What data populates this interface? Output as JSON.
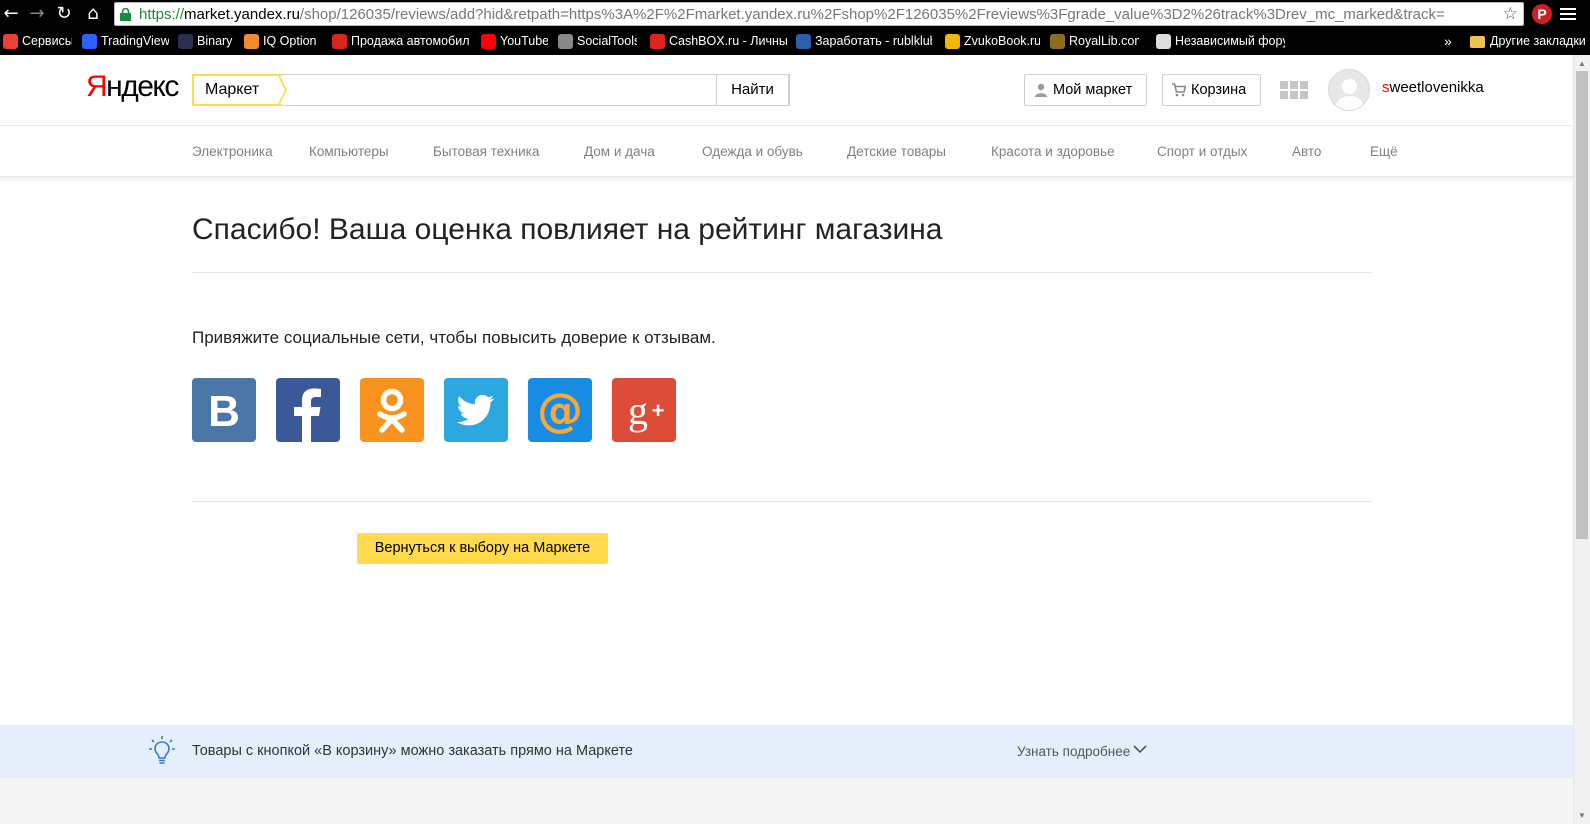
{
  "browser": {
    "url_https": "https://",
    "url_host": "market.yandex.ru",
    "url_path": "/shop/126035/reviews/add?hid&retpath=https%3A%2F%2Fmarket.yandex.ru%2Fshop%2F126035%2Freviews%3Fgrade_value%3D2%26track%3Drev_mc_marked&track="
  },
  "bookmarks": [
    {
      "label": "Сервисы",
      "icon": "apps-icon",
      "color": "#e94235"
    },
    {
      "label": "TradingView",
      "icon": "tradingview-icon",
      "color": "#2962ff"
    },
    {
      "label": "Binary",
      "icon": "binary-icon",
      "color": "#2a3052"
    },
    {
      "label": "IQ Option",
      "icon": "iq-option-icon",
      "color": "#f28c28"
    },
    {
      "label": "Продажа автомобил",
      "icon": "auto-icon",
      "color": "#d9261c"
    },
    {
      "label": "YouTube",
      "icon": "youtube-icon",
      "color": "#ff0000"
    },
    {
      "label": "SocialTools",
      "icon": "socialtools-icon",
      "color": "#888888"
    },
    {
      "label": "CashBOX.ru - Личный",
      "icon": "cashbox-icon",
      "color": "#e2231a"
    },
    {
      "label": "Заработать - rublklub",
      "icon": "rublklub-icon",
      "color": "#2b5fae"
    },
    {
      "label": "ZvukoBook.ru",
      "icon": "zvukobook-icon",
      "color": "#f2b705"
    },
    {
      "label": "RoyalLib.com",
      "icon": "royallib-icon",
      "color": "#8a6d1f"
    },
    {
      "label": "Независимый форум",
      "icon": "page-icon",
      "color": "#dddddd"
    }
  ],
  "bookmarks_more": "»",
  "bookmarks_other": "Другие закладки",
  "header": {
    "logo_first": "Я",
    "logo_rest": "ндекс",
    "search_tag": "Маркет",
    "search_button": "Найти",
    "my_market": "Мой маркет",
    "cart": "Корзина",
    "username_first": "s",
    "username_rest": "weetlovenikka"
  },
  "categories": [
    "Электроника",
    "Компьютеры",
    "Бытовая техника",
    "Дом и дача",
    "Одежда и обувь",
    "Детские товары",
    "Красота и здоровье",
    "Спорт и отдых",
    "Авто",
    "Ещё"
  ],
  "main": {
    "title": "Спасибо! Ваша оценка повлияет на рейтинг магазина",
    "subtitle": "Привяжите социальные сети, чтобы повысить доверие к отзывам.",
    "socials": [
      {
        "name": "vk",
        "color": "#4a76a8"
      },
      {
        "name": "facebook",
        "color": "#3b5998"
      },
      {
        "name": "odnoklassniki",
        "color": "#f7931e"
      },
      {
        "name": "twitter",
        "color": "#2ca7e0"
      },
      {
        "name": "mailru",
        "color": "#168de2"
      },
      {
        "name": "google-plus",
        "color": "#dd4b39"
      }
    ],
    "back_button": "Вернуться к выбору на Маркете"
  },
  "infobar": {
    "text": "Товары с кнопкой «В корзину» можно заказать прямо на Маркете",
    "link": "Узнать подробнее"
  },
  "colors": {
    "accent_yellow": "#ffdb4d",
    "infobar_bg": "#e5effb"
  }
}
